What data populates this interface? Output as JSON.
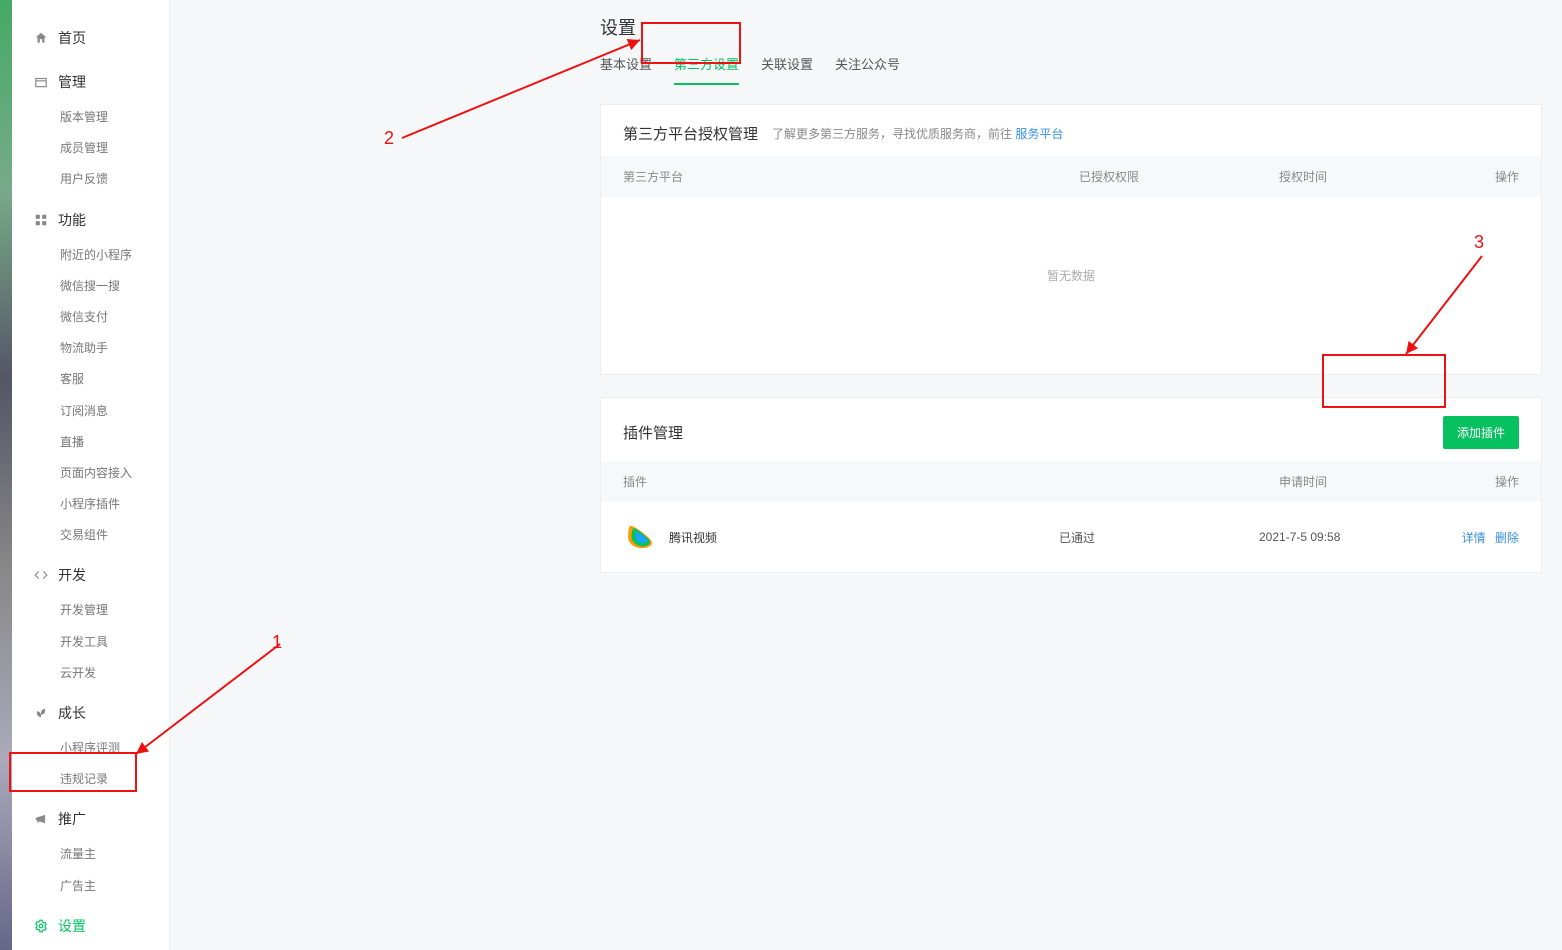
{
  "sidebar": {
    "groups": [
      {
        "icon": "home",
        "label": "首页",
        "items": []
      },
      {
        "icon": "box",
        "label": "管理",
        "items": [
          "版本管理",
          "成员管理",
          "用户反馈"
        ]
      },
      {
        "icon": "grid",
        "label": "功能",
        "items": [
          "附近的小程序",
          "微信搜一搜",
          "微信支付",
          "物流助手",
          "客服",
          "订阅消息",
          "直播",
          "页面内容接入",
          "小程序插件",
          "交易组件"
        ]
      },
      {
        "icon": "code",
        "label": "开发",
        "items": [
          "开发管理",
          "开发工具",
          "云开发"
        ]
      },
      {
        "icon": "sprout",
        "label": "成长",
        "items": [
          "小程序评测",
          "违规记录"
        ]
      },
      {
        "icon": "megaphone",
        "label": "推广",
        "items": [
          "流量主",
          "广告主"
        ]
      },
      {
        "icon": "gear",
        "label": "设置",
        "items": [],
        "active": true
      }
    ]
  },
  "page": {
    "title": "设置"
  },
  "tabs": [
    "基本设置",
    "第三方设置",
    "关联设置",
    "关注公众号"
  ],
  "active_tab": "第三方设置",
  "auth_panel": {
    "title": "第三方平台授权管理",
    "subtitle": "了解更多第三方服务，寻找优质服务商，前往",
    "link": "服务平台",
    "cols": [
      "第三方平台",
      "已授权权限",
      "授权时间",
      "操作"
    ],
    "empty": "暂无数据"
  },
  "plugin_panel": {
    "title": "插件管理",
    "add_btn": "添加插件",
    "cols": [
      "插件",
      "申请时间",
      "操作"
    ],
    "rows": [
      {
        "name": "腾讯视频",
        "status": "已通过",
        "time": "2021-7-5 09:58",
        "detail": "详情",
        "delete": "删除"
      }
    ]
  },
  "annotations": {
    "n1": "1",
    "n2": "2",
    "n3": "3"
  }
}
